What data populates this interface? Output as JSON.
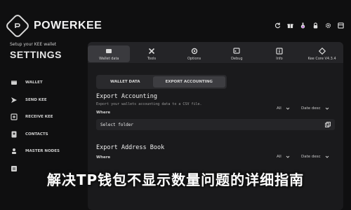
{
  "brand": {
    "name": "POWERKEE"
  },
  "sidebar": {
    "setup_text": "Setup your KEE wallet",
    "title": "SETTINGS",
    "items": [
      {
        "label": "WALLET",
        "icon": "wallet-icon"
      },
      {
        "label": "SEND KEE",
        "icon": "send-icon"
      },
      {
        "label": "RECEIVE KEE",
        "icon": "receive-icon"
      },
      {
        "label": "CONTACTS",
        "icon": "contacts-icon"
      },
      {
        "label": "MASTER NODES",
        "icon": "server-icon"
      },
      {
        "label": "",
        "icon": "doc-icon"
      }
    ]
  },
  "topbar": {
    "icons": [
      "refresh-icon",
      "gift-icon",
      "potion-icon",
      "lock-icon",
      "settings-icon",
      "box-icon"
    ]
  },
  "tabs": [
    {
      "label": "Wallet data",
      "icon": "wallet-data-icon",
      "active": true
    },
    {
      "label": "Tools",
      "icon": "tools-icon",
      "active": false
    },
    {
      "label": "Options",
      "icon": "options-icon",
      "active": false
    },
    {
      "label": "Debug",
      "icon": "debug-icon",
      "active": false
    },
    {
      "label": "Info",
      "icon": "info-icon",
      "active": false
    },
    {
      "label": "Kee Core V4.3.4",
      "icon": "kee-core-icon",
      "active": false
    }
  ],
  "subtabs": [
    {
      "label": "WALLET DATA",
      "active": false
    },
    {
      "label": "EXPORT ACCOUNTING",
      "active": true
    }
  ],
  "export_accounting": {
    "title": "Export Accounting",
    "description": "Export your wallets accounting data to a CSV file.",
    "where_label": "Where",
    "filter_value": "All",
    "sort_value": "Date desc",
    "folder_label": "Select folder"
  },
  "export_address": {
    "title": "Export Address Book",
    "where_label": "Where",
    "filter_value": "All",
    "sort_value": "Date desc"
  },
  "caption": "解决TP钱包不显示数量问题的详细指南",
  "colors": {
    "background": "#0f0f10",
    "panel": "#1a1a1c",
    "tabbar": "#242427"
  }
}
